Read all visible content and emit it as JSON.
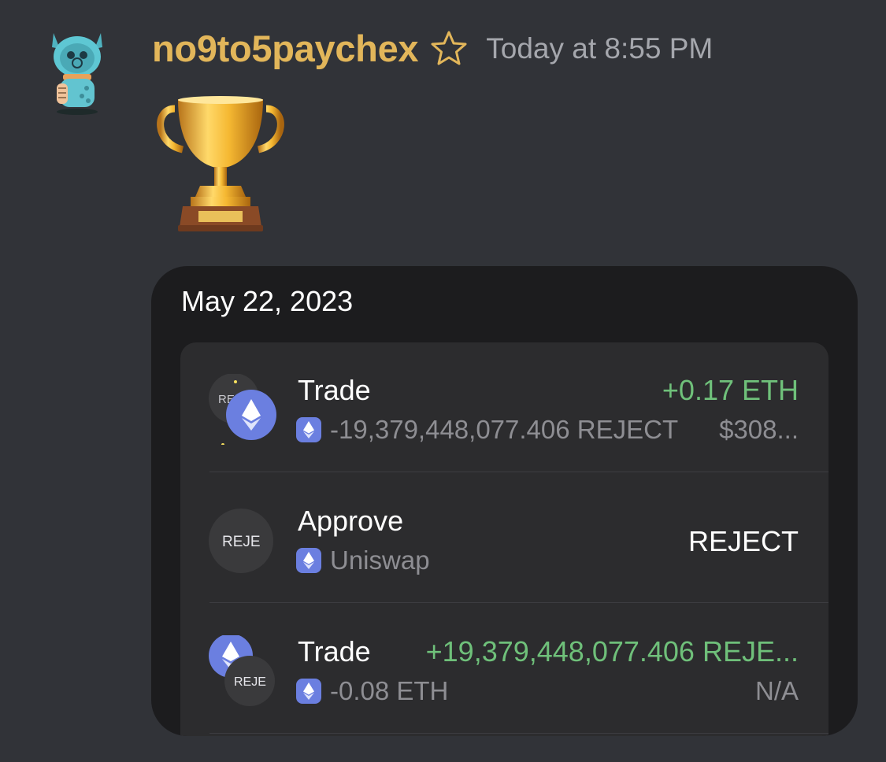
{
  "message": {
    "username": "no9to5paychex",
    "timestamp": "Today at 8:55 PM",
    "badge_icon": "star-outline-icon",
    "emoji": "trophy-icon"
  },
  "card": {
    "date": "May 22, 2023",
    "transactions": [
      {
        "title": "Trade",
        "subtitle": "-19,379,448,077.406 REJECT",
        "amount": "+0.17 ETH",
        "amount_color": "#6fc07a",
        "value": "$308...",
        "token_label": "REJE",
        "icon": "reje-eth-swap-icon"
      },
      {
        "title": "Approve",
        "subtitle": "Uniswap",
        "amount": "REJECT",
        "amount_color": "#ffffff",
        "value": "",
        "token_label": "REJE",
        "icon": "reje-token-icon"
      },
      {
        "title": "Trade",
        "subtitle": "-0.08 ETH",
        "amount": "+19,379,448,077.406 REJE...",
        "amount_color": "#6fc07a",
        "value": "N/A",
        "token_label": "REJE",
        "icon": "eth-reje-swap-icon"
      }
    ]
  },
  "colors": {
    "background": "#313338",
    "username": "#e2b65a",
    "card": "#1c1c1e",
    "list": "#2c2c2e",
    "eth": "#6b7fe0",
    "positive": "#6fc07a"
  }
}
